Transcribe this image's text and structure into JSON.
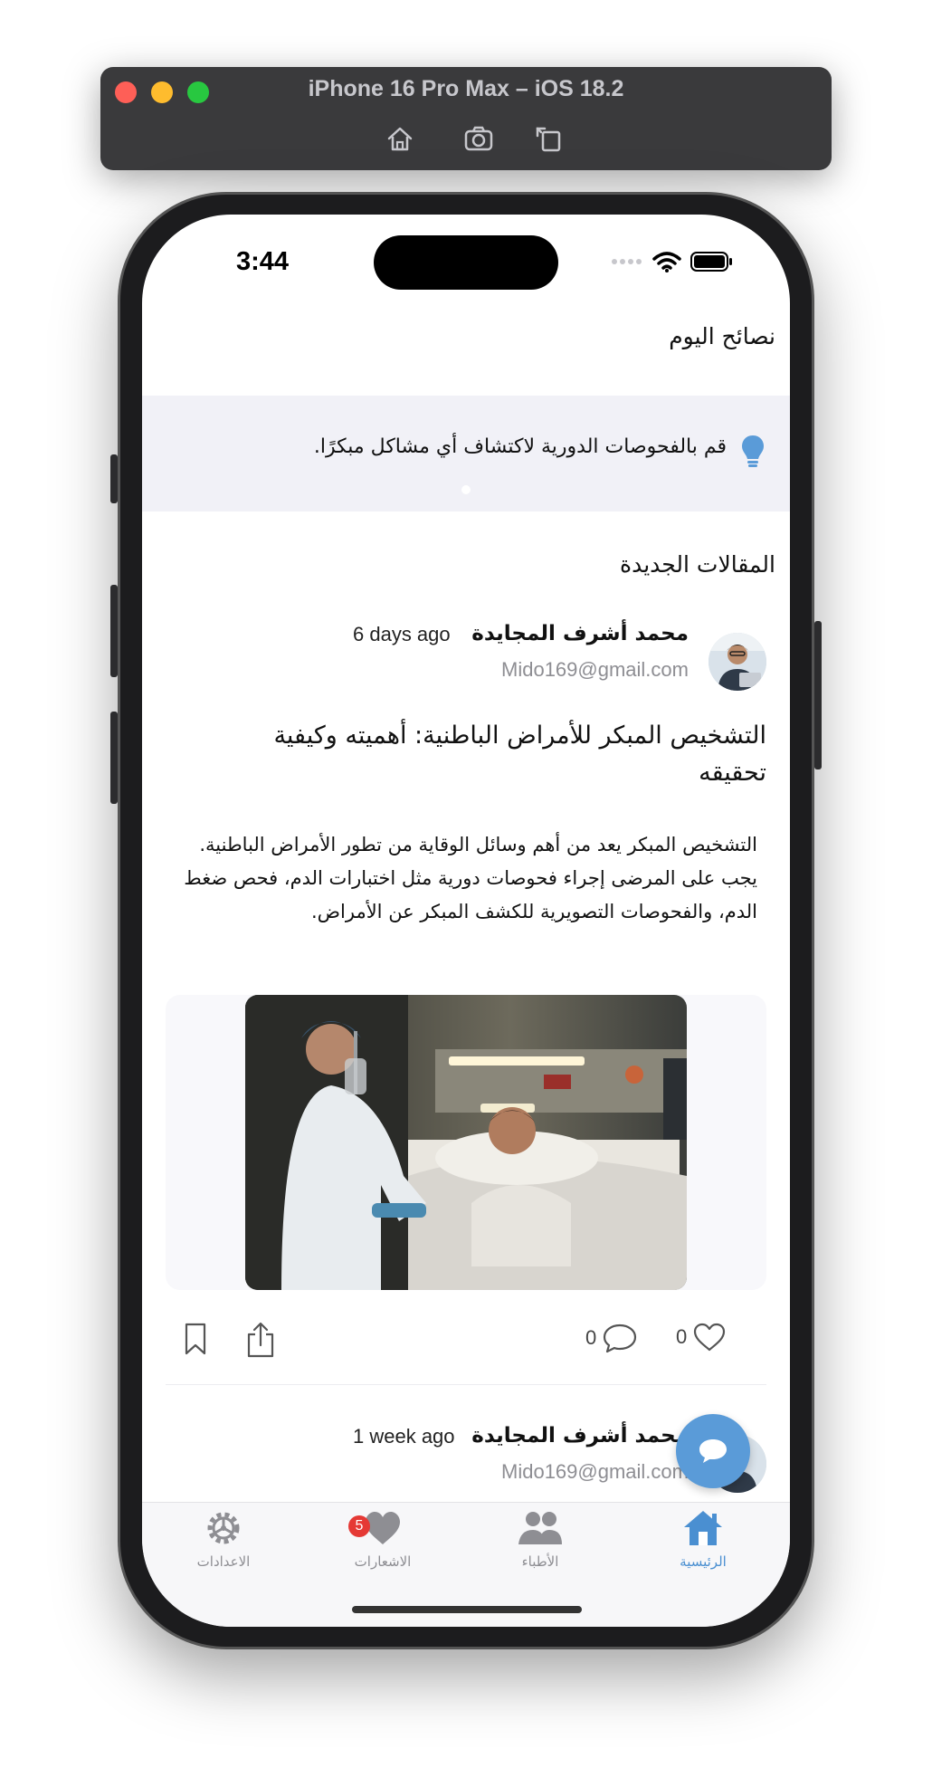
{
  "simulator": {
    "title": "iPhone 16 Pro Max – iOS 18.2"
  },
  "status_bar": {
    "time": "3:44"
  },
  "tips": {
    "section_title": "نصائح اليوم",
    "tip_text": "قم بالفحوصات الدورية لاكتشاف أي مشاكل مبكرًا."
  },
  "articles": {
    "section_title": "المقالات الجديدة",
    "post1": {
      "author": "محمد أشرف المجايدة",
      "time": "6 days ago",
      "email": "Mido169@gmail.com",
      "title": "التشخيص المبكر للأمراض الباطنية: أهميته وكيفية تحقيقه",
      "body": "التشخيص المبكر يعد من أهم وسائل الوقاية من تطور الأمراض الباطنية. يجب على المرضى إجراء فحوصات دورية مثل اختبارات الدم، فحص ضغط الدم، والفحوصات التصويرية للكشف المبكر عن الأمراض.",
      "likes": "0",
      "comments": "0"
    },
    "post2": {
      "author": "محمد أشرف المجايدة",
      "time": "1 week ago",
      "email": "Mido169@gmail.com"
    }
  },
  "tabbar": {
    "home": "الرئيسية",
    "doctors": "الأطباء",
    "notifications": "الاشعارات",
    "notifications_badge": "5",
    "settings": "الاعدادات"
  },
  "colors": {
    "accent": "#4a8fd1",
    "tip_band": "#f1f1f7",
    "badge": "#e53935"
  }
}
